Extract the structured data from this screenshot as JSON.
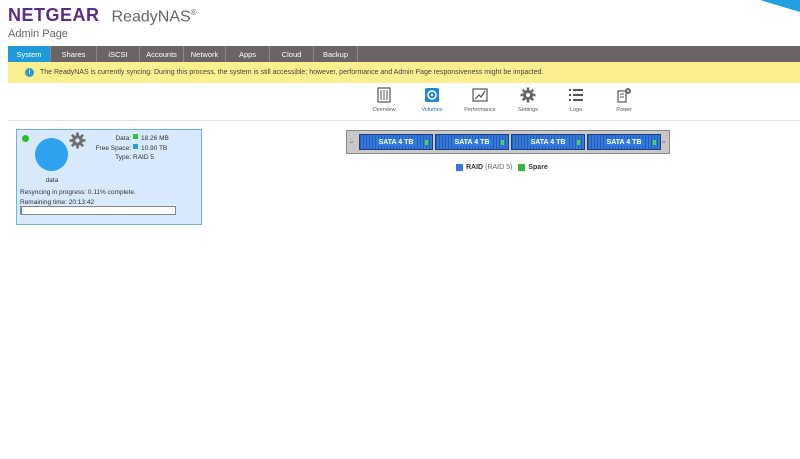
{
  "header": {
    "brand": "NETGEAR",
    "product": "ReadyNAS",
    "product_mark": "®",
    "page_title": "Admin Page"
  },
  "tabs": [
    {
      "label": "System",
      "active": true
    },
    {
      "label": "Shares"
    },
    {
      "label": "iSCSI"
    },
    {
      "label": "Accounts"
    },
    {
      "label": "Network"
    },
    {
      "label": "Apps"
    },
    {
      "label": "Cloud"
    },
    {
      "label": "Backup"
    }
  ],
  "notice": {
    "icon": "info-icon",
    "text": "The ReadyNAS is currently syncing. During this process, the system is still accessible; however, performance and Admin Page responsiveness might be impacted."
  },
  "toolbar": {
    "overview": "Overview",
    "volumes": "Volumes",
    "performance": "Performance",
    "settings": "Settings",
    "logs": "Logs",
    "power": "Power"
  },
  "volume": {
    "name": "data",
    "data_label": "Data:",
    "data_value": "18.26 MB",
    "free_label": "Free Space:",
    "free_value": "10.90 TB",
    "type_label": "Type:",
    "type_value": "RAID 5",
    "sync_text": "Resyncing in progress: 0.11% complete.",
    "remaining_text": "Remaining time: 20:13:42",
    "progress_fraction": 0.0011
  },
  "bay": {
    "left_label": "1",
    "right_label": "2",
    "disks": [
      "SATA 4 TB",
      "SATA 4 TB",
      "SATA 4 TB",
      "SATA 4 TB"
    ]
  },
  "legend": {
    "raid_label": "RAID",
    "raid_detail": "(RAID 5)",
    "spare_label": "Spare"
  },
  "colors": {
    "brand": "#5b2b86",
    "tab_active": "#1f9ad9",
    "notice_bg": "#fbf08f",
    "disk": "#3279e0",
    "spare": "#3ab43a"
  }
}
